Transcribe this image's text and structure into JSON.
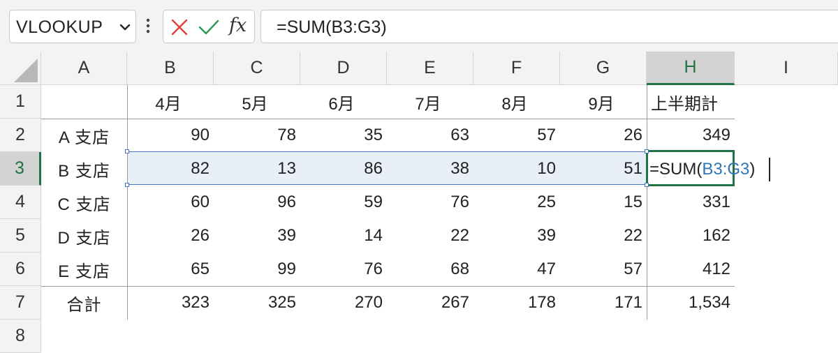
{
  "formula_bar": {
    "name_box": "VLOOKUP",
    "icons": [
      "chevron-down-icon",
      "more-icon",
      "cancel-icon",
      "enter-icon",
      "insert-function-icon"
    ],
    "fx_label": "fx",
    "formula": "=SUM(B3:G3)"
  },
  "columns": [
    "A",
    "B",
    "C",
    "D",
    "E",
    "F",
    "G",
    "H",
    "I"
  ],
  "rows": [
    "1",
    "2",
    "3",
    "4",
    "5",
    "6",
    "7",
    "8"
  ],
  "table": {
    "header": [
      "",
      "4月",
      "5月",
      "6月",
      "7月",
      "8月",
      "9月",
      "上半期計"
    ],
    "body": [
      [
        "A 支店",
        "90",
        "78",
        "35",
        "63",
        "57",
        "26",
        "349"
      ],
      [
        "B 支店",
        "82",
        "13",
        "86",
        "38",
        "10",
        "51",
        ""
      ],
      [
        "C 支店",
        "60",
        "96",
        "59",
        "76",
        "25",
        "15",
        "331"
      ],
      [
        "D 支店",
        "26",
        "39",
        "14",
        "22",
        "39",
        "22",
        "162"
      ],
      [
        "E 支店",
        "65",
        "99",
        "76",
        "68",
        "47",
        "57",
        "412"
      ],
      [
        "合計",
        "323",
        "325",
        "270",
        "267",
        "178",
        "171",
        "1,534"
      ]
    ]
  },
  "edit": {
    "prefix": "=SUM(",
    "range": "B3:G3",
    "suffix": ")"
  },
  "colors": {
    "active_header": "#217346",
    "range_highlight": "#4472c4",
    "range_text": "#2f75b5"
  }
}
